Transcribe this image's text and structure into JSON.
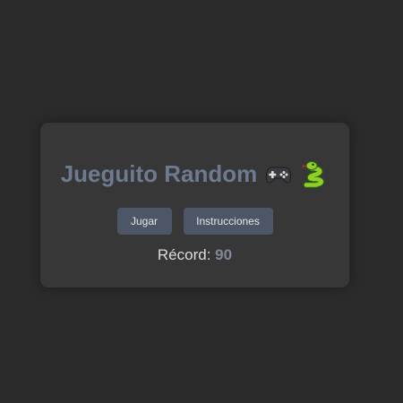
{
  "menu": {
    "title": "Jueguito Random",
    "icons": [
      "gamepad-icon",
      "snake-icon"
    ],
    "play_label": "Jugar",
    "instructions_label": "Instrucciones",
    "record_label": "Récord:",
    "record_value": "90"
  },
  "colors": {
    "background": "#2b2b2b",
    "card": "#373737",
    "title": "#6d7a8f",
    "button": "#4d5666",
    "button_text": "#e4e6ea",
    "record_value": "#7d8899"
  }
}
